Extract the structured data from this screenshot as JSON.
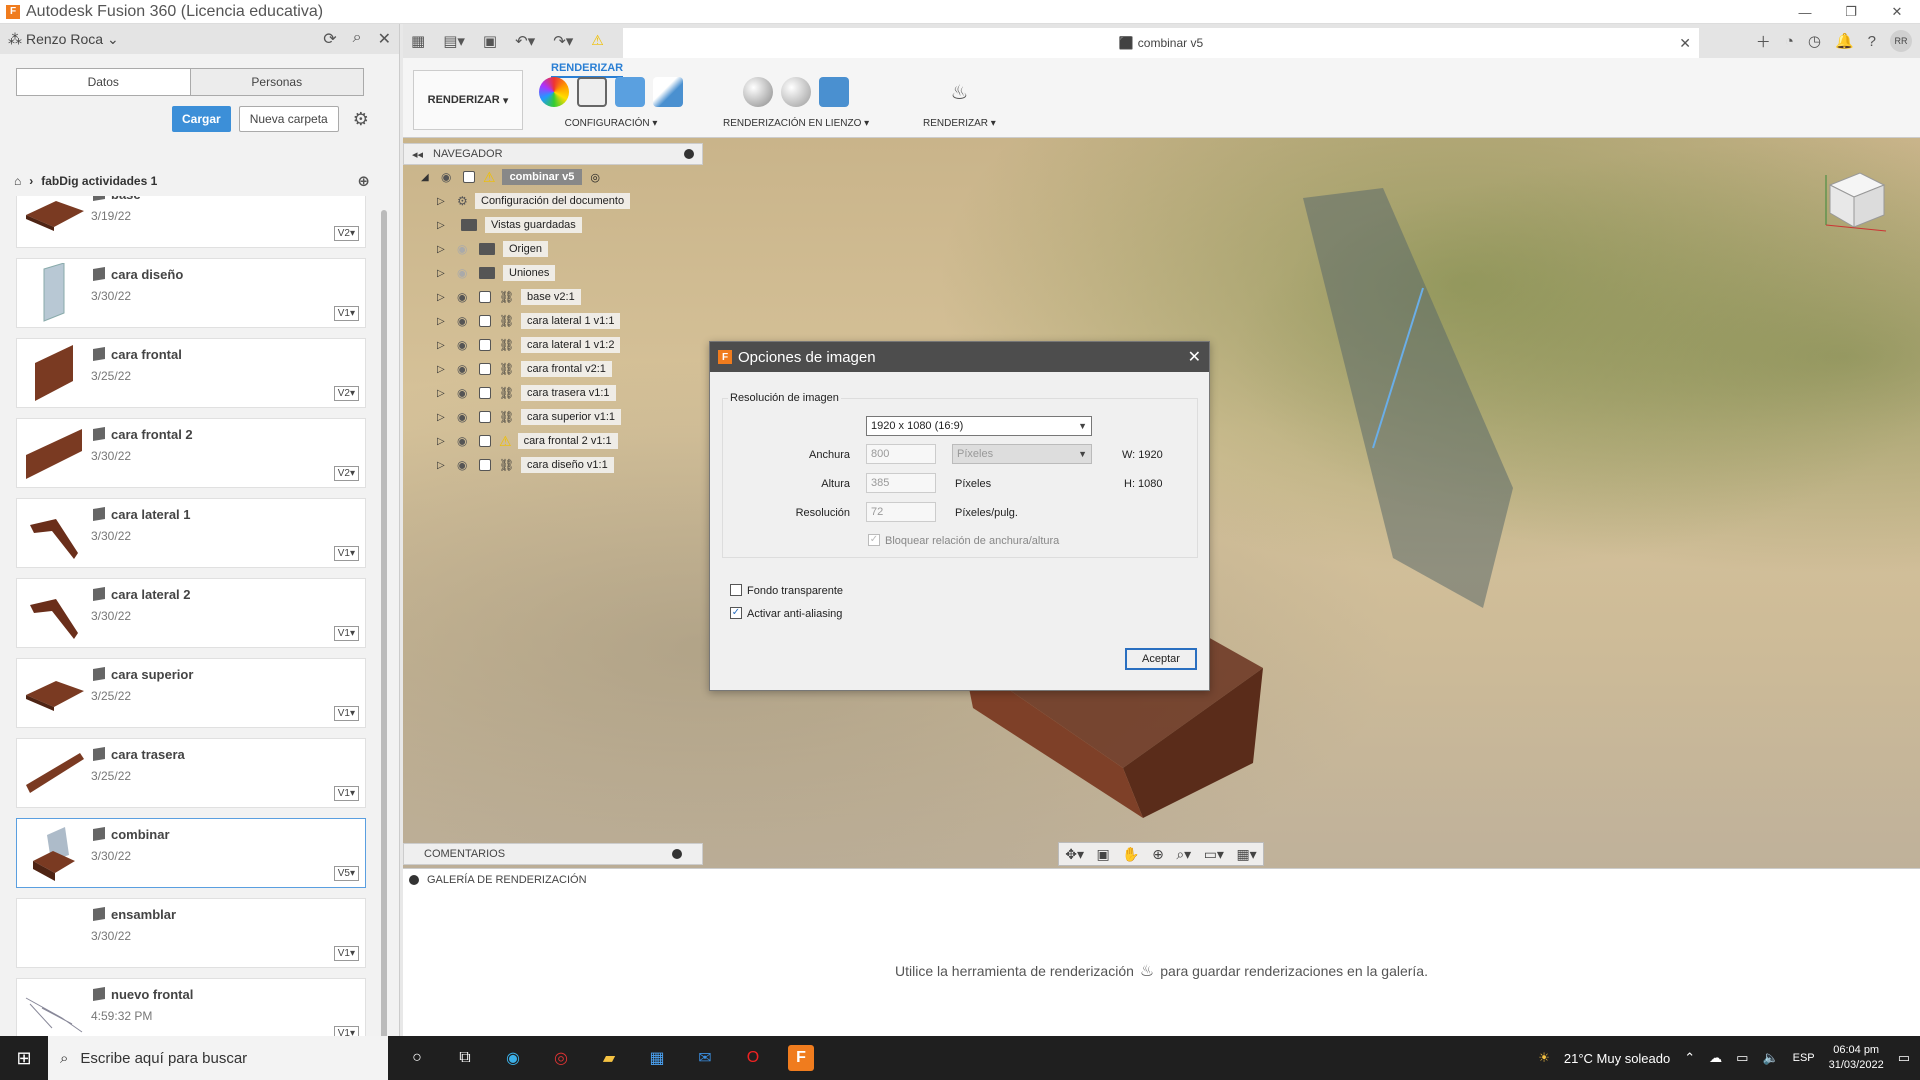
{
  "window": {
    "title": "Autodesk Fusion 360 (Licencia educativa)"
  },
  "data_panel": {
    "user": "Renzo Roca",
    "tabs": [
      "Datos",
      "Personas"
    ],
    "upload_label": "Cargar",
    "new_folder_label": "Nueva carpeta",
    "breadcrumb": "fabDig actividades 1",
    "files": [
      {
        "name": "base",
        "date": "3/19/22",
        "version": "V2"
      },
      {
        "name": "cara diseño",
        "date": "3/30/22",
        "version": "V1"
      },
      {
        "name": "cara frontal",
        "date": "3/25/22",
        "version": "V2"
      },
      {
        "name": "cara frontal 2",
        "date": "3/30/22",
        "version": "V2"
      },
      {
        "name": "cara lateral 1",
        "date": "3/30/22",
        "version": "V1"
      },
      {
        "name": "cara lateral 2",
        "date": "3/30/22",
        "version": "V1"
      },
      {
        "name": "cara superior",
        "date": "3/25/22",
        "version": "V1"
      },
      {
        "name": "cara trasera",
        "date": "3/25/22",
        "version": "V1"
      },
      {
        "name": "combinar",
        "date": "3/30/22",
        "version": "V5"
      },
      {
        "name": "ensamblar",
        "date": "3/30/22",
        "version": "V1"
      },
      {
        "name": "nuevo frontal",
        "date": "4:59:32 PM",
        "version": "V1"
      }
    ]
  },
  "document_tab": {
    "title": "combinar v5"
  },
  "toolbar": {
    "workspace_tab": "RENDERIZAR",
    "workspace_button": "RENDERIZAR",
    "groups": [
      "CONFIGURACIÓN",
      "RENDERIZACIÓN EN LIENZO",
      "RENDERIZAR"
    ]
  },
  "navigator": {
    "title": "NAVEGADOR",
    "root": "combinar v5",
    "items": [
      "Configuración del documento",
      "Vistas guardadas",
      "Origen",
      "Uniones",
      "base v2:1",
      "cara lateral 1 v1:1",
      "cara lateral 1 v1:2",
      "cara frontal v2:1",
      "cara trasera v1:1",
      "cara superior v1:1",
      "cara frontal 2 v1:1",
      "cara diseño v1:1"
    ]
  },
  "comments": {
    "title": "COMENTARIOS"
  },
  "gallery": {
    "title": "GALERÍA DE RENDERIZACIÓN",
    "msg_before": "Utilice la herramienta de renderización",
    "msg_after": "para guardar renderizaciones en la galería."
  },
  "dialog": {
    "title": "Opciones de imagen",
    "section": "Resolución de imagen",
    "preset": "1920 x 1080 (16:9)",
    "width_label": "Anchura",
    "width_value": "800",
    "unit_select": "Píxeles",
    "width_readout": "W: 1920",
    "height_label": "Altura",
    "height_value": "385",
    "height_unit": "Píxeles",
    "height_readout": "H: 1080",
    "resolution_label": "Resolución",
    "resolution_value": "72",
    "resolution_unit": "Píxeles/pulg.",
    "lock_ratio": "Bloquear relación de anchura/altura",
    "transparent_bg": "Fondo transparente",
    "antialias": "Activar anti-aliasing",
    "ok_label": "Aceptar"
  },
  "taskbar": {
    "search_placeholder": "Escribe aquí para buscar",
    "weather": "21°C  Muy soleado",
    "lang": "ESP",
    "time": "06:04 pm",
    "date": "31/03/2022"
  }
}
